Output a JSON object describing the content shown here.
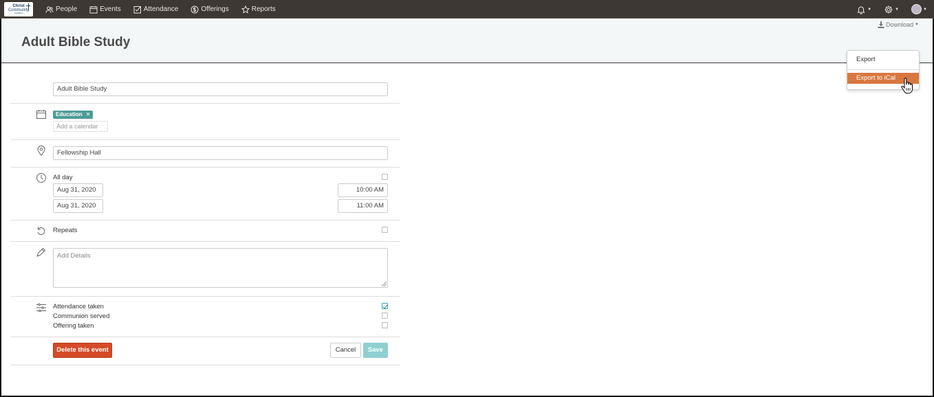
{
  "logo": {
    "line1": "Christ",
    "line2": "Community",
    "line3": "CHURCH"
  },
  "nav": {
    "items": [
      {
        "label": "People",
        "icon": "people-icon"
      },
      {
        "label": "Events",
        "icon": "calendar-icon"
      },
      {
        "label": "Attendance",
        "icon": "checkbox-icon"
      },
      {
        "label": "Offerings",
        "icon": "coin-icon"
      },
      {
        "label": "Reports",
        "icon": "star-icon"
      }
    ],
    "right_icons": [
      "bell-icon",
      "gear-icon",
      "avatar"
    ]
  },
  "header": {
    "title": "Adult Bible Study",
    "download_label": "Download"
  },
  "download_menu": {
    "items": [
      "Export",
      "Export to iCal"
    ],
    "highlighted": "Export to iCal",
    "highlight_color": "#d8773f"
  },
  "form": {
    "name_value": "Adult Bible Study",
    "calendar_tag": "Education",
    "calendar_tag_color": "#4e9c97",
    "add_calendar_placeholder": "Add a calendar",
    "location_value": "Fellowship Hall",
    "all_day_label": "All day",
    "all_day_checked": false,
    "start_date": "Aug 31, 2020",
    "start_time": "10:00 AM",
    "end_date": "Aug 31, 2020",
    "end_time": "11:00 AM",
    "repeats_label": "Repeats",
    "repeats_checked": false,
    "details_placeholder": "Add Details",
    "options": [
      {
        "label": "Attendance taken",
        "checked": true
      },
      {
        "label": "Communion served",
        "checked": false
      },
      {
        "label": "Offering taken",
        "checked": false
      }
    ],
    "delete_label": "Delete this event",
    "cancel_label": "Cancel",
    "save_label": "Save",
    "delete_color": "#d54a26",
    "save_color": "#8fcfd2"
  }
}
